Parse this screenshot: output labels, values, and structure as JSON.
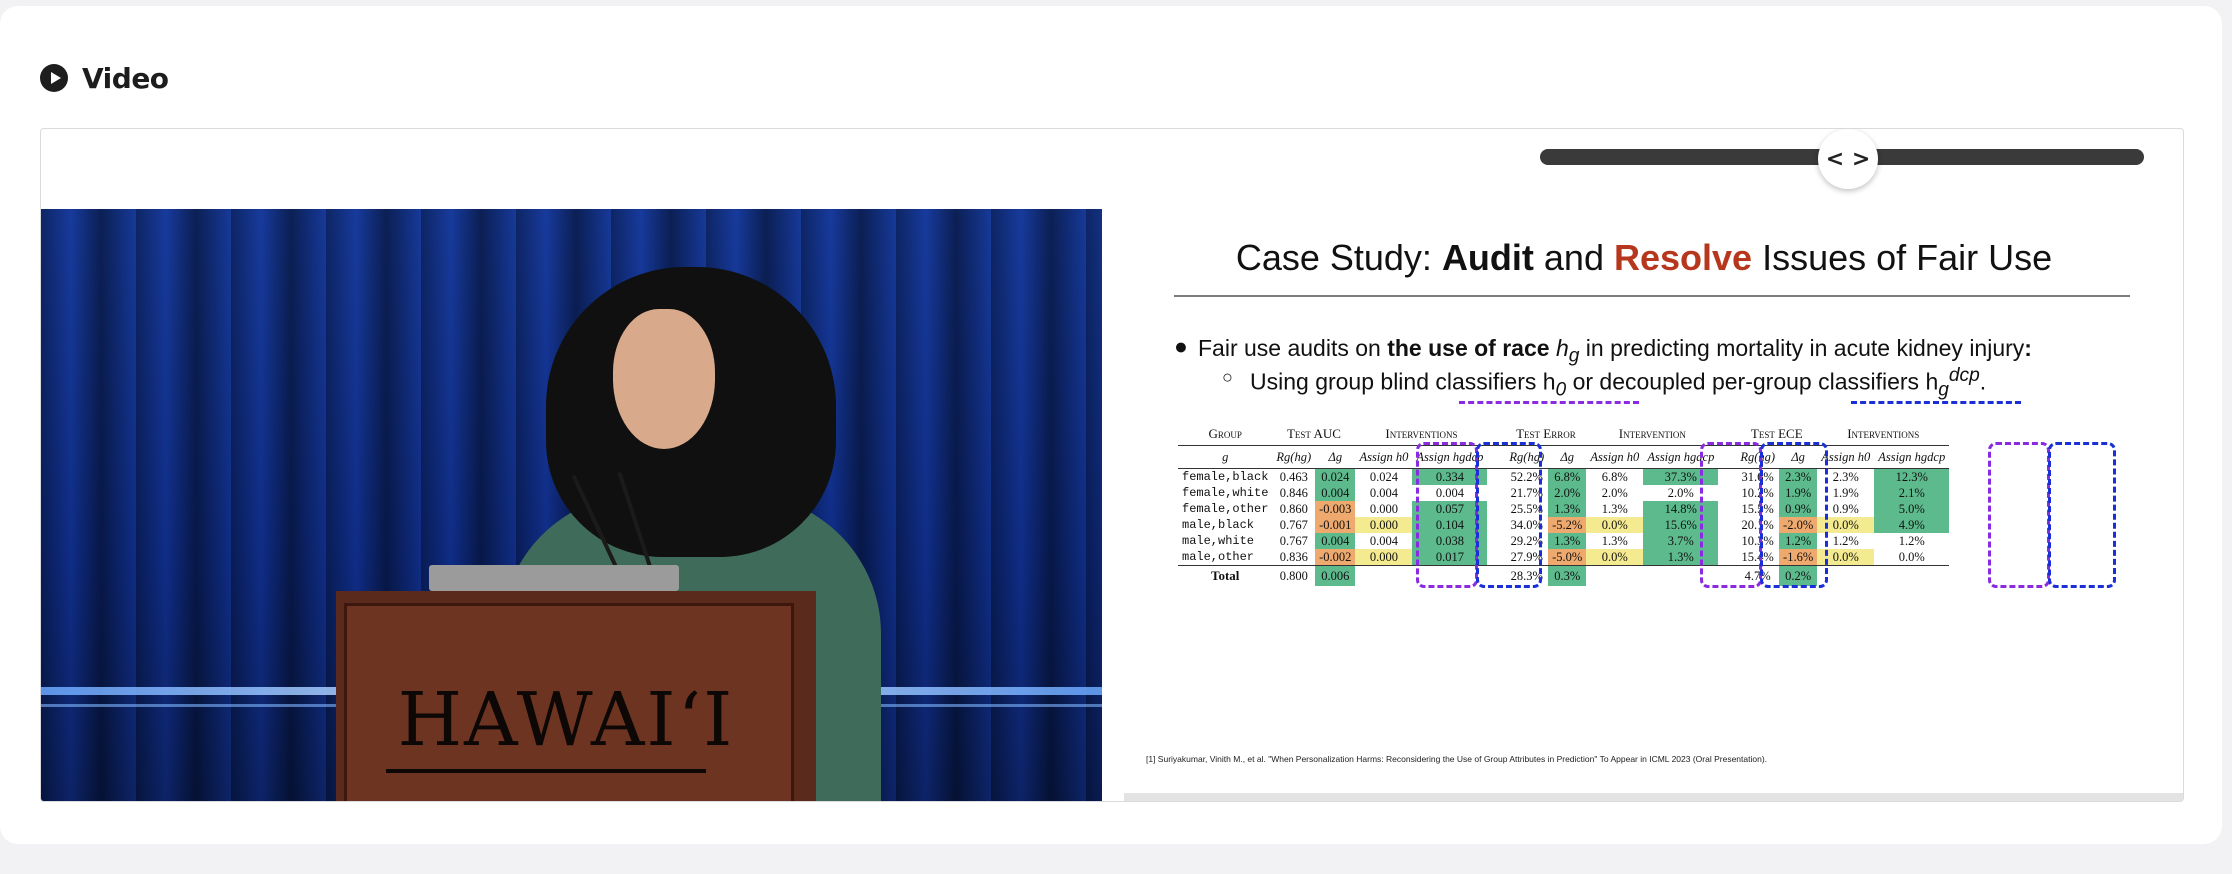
{
  "header": {
    "title": "Video",
    "icon": "play-circle-icon"
  },
  "player": {
    "slider_handle_glyph": "< >",
    "podium_text": "HAWAIʻI"
  },
  "slide": {
    "title_prefix": "Case Study: ",
    "title_audit": "Audit",
    "title_and": " and ",
    "title_resolve": "Resolve",
    "title_suffix": " Issues of Fair Use",
    "bullet1": {
      "t1": "Fair use audits on ",
      "bold": "the use of race",
      "t2": " h",
      "sub": "g",
      "t3": " in predicting mortality in acute kidney injury",
      "colon": ":"
    },
    "bullet2": {
      "t1": "Using group blind classifiers h",
      "sub": "0",
      "t2": " or decoupled per-group classifiers h",
      "sub2": "g",
      "sup2": "dcp",
      "t3": "."
    },
    "table": {
      "group_headers": [
        "Group",
        "Test AUC",
        "Interventions",
        "Test Error",
        "Intervention",
        "Test ECE",
        "Interventions"
      ],
      "sub_headers": [
        "g",
        "Rg(hg)",
        "Δg",
        "Assign h0",
        "Assign hgdcp",
        "Rg(hg)",
        "Δg",
        "Assign h0",
        "Assign hgdcp",
        "Rg(hg)",
        "Δg",
        "Assign h0",
        "Assign hgdcp"
      ],
      "rows": [
        {
          "g": "female,black",
          "auc": "0.463",
          "auc_d": "0.024",
          "auc_h0": "0.024",
          "auc_hd": "0.334",
          "err": "52.2%",
          "err_d": "6.8%",
          "err_h0": "6.8%",
          "err_hd": "37.3%",
          "ece": "31.6%",
          "ece_d": "2.3%",
          "ece_h0": "2.3%",
          "ece_hd": "12.3%"
        },
        {
          "g": "female,white",
          "auc": "0.846",
          "auc_d": "0.004",
          "auc_h0": "0.004",
          "auc_hd": "0.004",
          "err": "21.7%",
          "err_d": "2.0%",
          "err_h0": "2.0%",
          "err_hd": "2.0%",
          "ece": "10.2%",
          "ece_d": "1.9%",
          "ece_h0": "1.9%",
          "ece_hd": "2.1%"
        },
        {
          "g": "female,other",
          "auc": "0.860",
          "auc_d": "-0.003",
          "auc_h0": "0.000",
          "auc_hd": "0.057",
          "err": "25.5%",
          "err_d": "1.3%",
          "err_h0": "1.3%",
          "err_hd": "14.8%",
          "ece": "15.5%",
          "ece_d": "0.9%",
          "ece_h0": "0.9%",
          "ece_hd": "5.0%"
        },
        {
          "g": "male,black",
          "auc": "0.767",
          "auc_d": "-0.001",
          "auc_h0": "0.000",
          "auc_hd": "0.104",
          "err": "34.0%",
          "err_d": "-5.2%",
          "err_h0": "0.0%",
          "err_hd": "15.6%",
          "ece": "20.1%",
          "ece_d": "-2.0%",
          "ece_h0": "0.0%",
          "ece_hd": "4.9%"
        },
        {
          "g": "male,white",
          "auc": "0.767",
          "auc_d": "0.004",
          "auc_h0": "0.004",
          "auc_hd": "0.038",
          "err": "29.2%",
          "err_d": "1.3%",
          "err_h0": "1.3%",
          "err_hd": "3.7%",
          "ece": "10.3%",
          "ece_d": "1.2%",
          "ece_h0": "1.2%",
          "ece_hd": "1.2%"
        },
        {
          "g": "male,other",
          "auc": "0.836",
          "auc_d": "-0.002",
          "auc_h0": "0.000",
          "auc_hd": "0.017",
          "err": "27.9%",
          "err_d": "-5.0%",
          "err_h0": "0.0%",
          "err_hd": "1.3%",
          "ece": "15.4%",
          "ece_d": "-1.6%",
          "ece_h0": "0.0%",
          "ece_hd": "0.0%"
        }
      ],
      "total": {
        "label": "Total",
        "auc": "0.800",
        "auc_d": "0.006",
        "err": "28.3%",
        "err_d": "0.3%",
        "ece": "4.7%",
        "ece_d": "0.2%"
      }
    },
    "citation": "[1] Suriyakumar, Vinith M., et al. \"When Personalization Harms: Reconsidering the Use of Group Attributes in Prediction\" To Appear in ICML 2023 (Oral Presentation)."
  },
  "colors": {
    "green": "#5dba8d",
    "orange": "#eeaa6e",
    "yellow": "#f4ea90",
    "resolve": "#b7371e",
    "purple_box": "#8a2be2",
    "blue_box": "#1b2fd6"
  }
}
